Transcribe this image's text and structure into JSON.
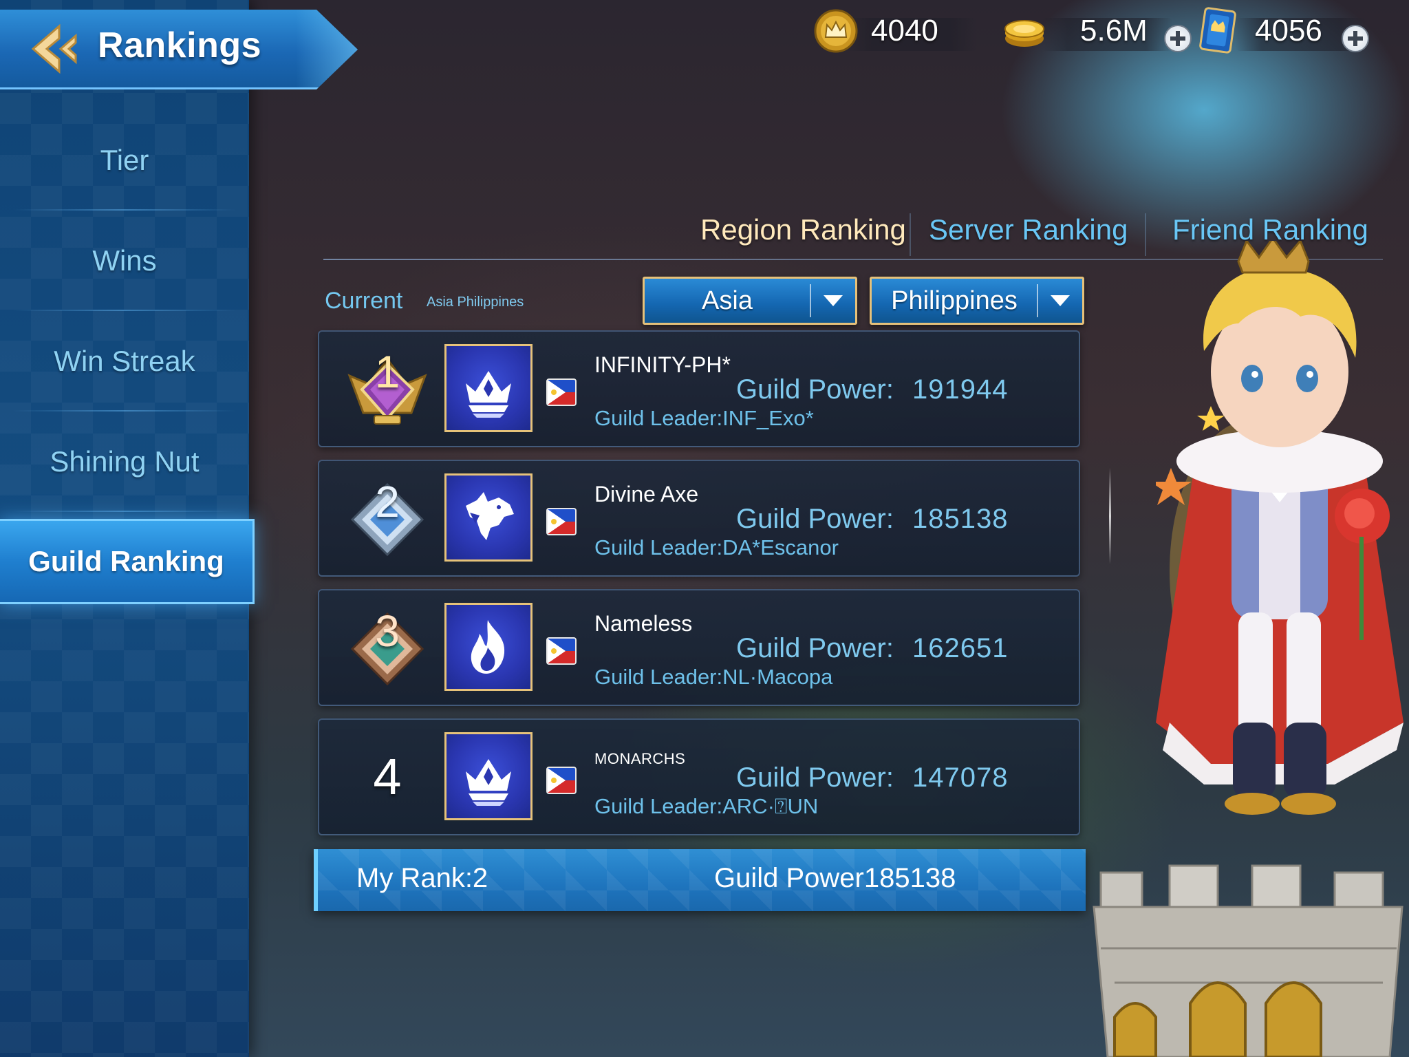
{
  "header": {
    "title": "Rankings",
    "back_icon": "back-arrow-icon"
  },
  "currencies": [
    {
      "icon": "crown-coin-icon",
      "amount": "4040",
      "has_plus": false
    },
    {
      "icon": "gold-coin-stack-icon",
      "amount": "5.6M",
      "has_plus": true
    },
    {
      "icon": "ticket-card-icon",
      "amount": "4056",
      "has_plus": true
    }
  ],
  "sidebar": {
    "items": [
      {
        "label": "Tier",
        "active": false
      },
      {
        "label": "Wins",
        "active": false
      },
      {
        "label": "Win Streak",
        "active": false
      },
      {
        "label": "Shining Nut",
        "active": false
      },
      {
        "label": "Guild Ranking",
        "active": true
      }
    ]
  },
  "tabs": [
    {
      "label": "Region Ranking",
      "active": true
    },
    {
      "label": "Server Ranking",
      "active": false
    },
    {
      "label": "Friend Ranking",
      "active": false
    }
  ],
  "filter": {
    "current_label": "Current",
    "current_value": "Asia Philippines",
    "region": "Asia",
    "country": "Philippines"
  },
  "rankings": [
    {
      "rank": "1",
      "badge": "gold-purple-rank-badge",
      "emblem": "crown-emblem-icon",
      "name": "INFINITY-PH*",
      "power_label": "Guild Power:",
      "power": "191944",
      "leader": "Guild Leader:INF_Exo*"
    },
    {
      "rank": "2",
      "badge": "silver-rank-badge",
      "emblem": "wolf-emblem-icon",
      "name": "Divine Axe",
      "power_label": "Guild Power:",
      "power": "185138",
      "leader": "Guild Leader:DA*Escanor"
    },
    {
      "rank": "3",
      "badge": "bronze-rank-badge",
      "emblem": "flame-emblem-icon",
      "name": "Nameless",
      "power_label": "Guild Power:",
      "power": "162651",
      "leader": "Guild Leader:NL·Macopa"
    },
    {
      "rank": "4",
      "badge": "",
      "emblem": "crown-emblem-icon",
      "name": "MONARCHS",
      "power_label": "Guild Power:",
      "power": "147078",
      "leader": "Guild Leader:ARC·⍰UN"
    }
  ],
  "my_rank": {
    "rank_text": "My Rank:2",
    "power_text": "Guild Power185138"
  },
  "colors": {
    "accent_blue": "#1f7fcf",
    "tab_active": "#ffe9bc",
    "tab_inactive": "#69c6f5",
    "gold_border": "#e6c17a"
  }
}
